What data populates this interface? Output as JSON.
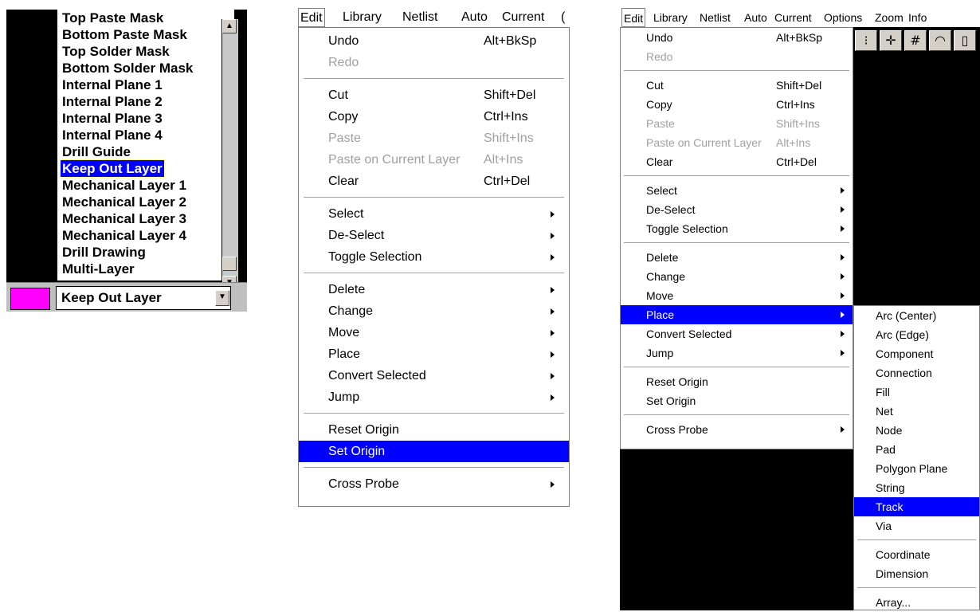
{
  "layer_panel": {
    "items": [
      "Top Paste Mask",
      "Bottom Paste Mask",
      "Top Solder Mask",
      "Bottom Solder Mask",
      "Internal Plane 1",
      "Internal Plane 2",
      "Internal Plane 3",
      "Internal Plane 4",
      "Drill Guide",
      "Keep Out Layer",
      "Mechanical Layer 1",
      "Mechanical Layer 2",
      "Mechanical Layer 3",
      "Mechanical Layer 4",
      "Drill Drawing",
      "Multi-Layer"
    ],
    "selected_index": 9,
    "current_layer": "Keep Out Layer",
    "swatch_color": "#ff00ff",
    "scroll_up_icon": "triangle-up-icon",
    "scroll_down_icon": "triangle-down-icon"
  },
  "menu_small": {
    "menubar": [
      "Edit",
      "Library",
      "Netlist",
      "Auto",
      "Current",
      "("
    ],
    "items": [
      {
        "label": "Undo",
        "shortcut": "Alt+BkSp"
      },
      {
        "label": "Redo",
        "disabled": true
      },
      {
        "sep": true
      },
      {
        "label": "Cut",
        "shortcut": "Shift+Del"
      },
      {
        "label": "Copy",
        "shortcut": "Ctrl+Ins"
      },
      {
        "label": "Paste",
        "shortcut": "Shift+Ins",
        "disabled": true
      },
      {
        "label": "Paste on Current Layer",
        "shortcut": "Alt+Ins",
        "disabled": true
      },
      {
        "label": "Clear",
        "shortcut": "Ctrl+Del"
      },
      {
        "sep": true
      },
      {
        "label": "Select",
        "submenu": true
      },
      {
        "label": "De-Select",
        "submenu": true
      },
      {
        "label": "Toggle Selection",
        "submenu": true
      },
      {
        "sep": true
      },
      {
        "label": "Delete",
        "submenu": true
      },
      {
        "label": "Change",
        "submenu": true
      },
      {
        "label": "Move",
        "submenu": true
      },
      {
        "label": "Place",
        "submenu": true
      },
      {
        "label": "Convert Selected",
        "submenu": true
      },
      {
        "label": "Jump",
        "submenu": true
      },
      {
        "sep": true
      },
      {
        "label": "Reset Origin"
      },
      {
        "label": "Set Origin",
        "highlighted": true
      },
      {
        "sep": true
      },
      {
        "label": "Cross Probe",
        "submenu": true
      }
    ]
  },
  "menu_full": {
    "menubar": [
      "Edit",
      "Library",
      "Netlist",
      "Auto",
      "Current",
      "Options",
      "Zoom",
      "Info"
    ],
    "items": [
      {
        "label": "Undo",
        "shortcut": "Alt+BkSp"
      },
      {
        "label": "Redo",
        "disabled": true
      },
      {
        "sep": true
      },
      {
        "label": "Cut",
        "shortcut": "Shift+Del"
      },
      {
        "label": "Copy",
        "shortcut": "Ctrl+Ins"
      },
      {
        "label": "Paste",
        "shortcut": "Shift+Ins",
        "disabled": true
      },
      {
        "label": "Paste on Current Layer",
        "shortcut": "Alt+Ins",
        "disabled": true
      },
      {
        "label": "Clear",
        "shortcut": "Ctrl+Del"
      },
      {
        "sep": true
      },
      {
        "label": "Select",
        "submenu": true
      },
      {
        "label": "De-Select",
        "submenu": true
      },
      {
        "label": "Toggle Selection",
        "submenu": true
      },
      {
        "sep": true
      },
      {
        "label": "Delete",
        "submenu": true
      },
      {
        "label": "Change",
        "submenu": true
      },
      {
        "label": "Move",
        "submenu": true
      },
      {
        "label": "Place",
        "submenu": true,
        "highlighted": true
      },
      {
        "label": "Convert Selected",
        "submenu": true
      },
      {
        "label": "Jump",
        "submenu": true
      },
      {
        "sep": true
      },
      {
        "label": "Reset Origin"
      },
      {
        "label": "Set Origin"
      },
      {
        "sep": true
      },
      {
        "label": "Cross Probe",
        "submenu": true
      }
    ],
    "toolbar_icons": [
      "grip-icon",
      "move-cross-icon",
      "grid-icon",
      "arc-icon",
      "component-icon"
    ],
    "place_submenu": [
      {
        "label": "Arc (Center)"
      },
      {
        "label": "Arc (Edge)"
      },
      {
        "label": "Component"
      },
      {
        "label": "Connection"
      },
      {
        "label": "Fill"
      },
      {
        "label": "Net"
      },
      {
        "label": "Node"
      },
      {
        "label": "Pad"
      },
      {
        "label": "Polygon Plane"
      },
      {
        "label": "String"
      },
      {
        "label": "Track",
        "highlighted": true
      },
      {
        "label": "Via"
      },
      {
        "sep": true
      },
      {
        "label": "Coordinate"
      },
      {
        "label": "Dimension"
      },
      {
        "sep": true
      },
      {
        "label": "Array..."
      }
    ]
  }
}
